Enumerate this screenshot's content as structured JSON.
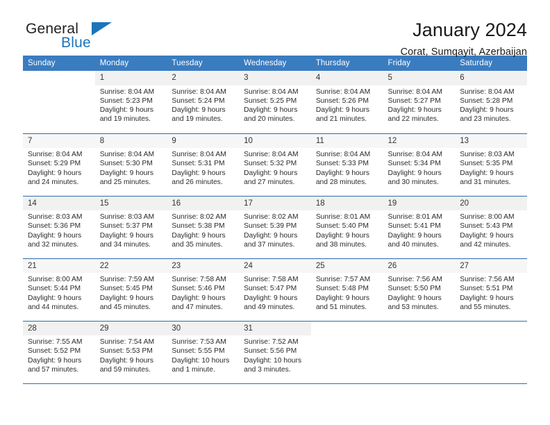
{
  "brand": {
    "name_part1": "General",
    "name_part2": "Blue",
    "logo_icon": "triangle-icon"
  },
  "header": {
    "title": "January 2024",
    "location": "Corat, Sumqayit, Azerbaijan"
  },
  "colors": {
    "header_bg": "#3a7cc0",
    "header_text": "#ffffff",
    "brand_blue": "#1b75bb",
    "daynum_bg": "#f1f1f1",
    "row_border": "#2f6ca8",
    "body_text": "#2b2b2b"
  },
  "calendar": {
    "weekdays": [
      "Sunday",
      "Monday",
      "Tuesday",
      "Wednesday",
      "Thursday",
      "Friday",
      "Saturday"
    ],
    "weeks": [
      [
        {
          "day": "",
          "sunrise": "",
          "sunset": "",
          "daylight": "",
          "daylight2": ""
        },
        {
          "day": "1",
          "sunrise": "Sunrise: 8:04 AM",
          "sunset": "Sunset: 5:23 PM",
          "daylight": "Daylight: 9 hours",
          "daylight2": "and 19 minutes."
        },
        {
          "day": "2",
          "sunrise": "Sunrise: 8:04 AM",
          "sunset": "Sunset: 5:24 PM",
          "daylight": "Daylight: 9 hours",
          "daylight2": "and 19 minutes."
        },
        {
          "day": "3",
          "sunrise": "Sunrise: 8:04 AM",
          "sunset": "Sunset: 5:25 PM",
          "daylight": "Daylight: 9 hours",
          "daylight2": "and 20 minutes."
        },
        {
          "day": "4",
          "sunrise": "Sunrise: 8:04 AM",
          "sunset": "Sunset: 5:26 PM",
          "daylight": "Daylight: 9 hours",
          "daylight2": "and 21 minutes."
        },
        {
          "day": "5",
          "sunrise": "Sunrise: 8:04 AM",
          "sunset": "Sunset: 5:27 PM",
          "daylight": "Daylight: 9 hours",
          "daylight2": "and 22 minutes."
        },
        {
          "day": "6",
          "sunrise": "Sunrise: 8:04 AM",
          "sunset": "Sunset: 5:28 PM",
          "daylight": "Daylight: 9 hours",
          "daylight2": "and 23 minutes."
        }
      ],
      [
        {
          "day": "7",
          "sunrise": "Sunrise: 8:04 AM",
          "sunset": "Sunset: 5:29 PM",
          "daylight": "Daylight: 9 hours",
          "daylight2": "and 24 minutes."
        },
        {
          "day": "8",
          "sunrise": "Sunrise: 8:04 AM",
          "sunset": "Sunset: 5:30 PM",
          "daylight": "Daylight: 9 hours",
          "daylight2": "and 25 minutes."
        },
        {
          "day": "9",
          "sunrise": "Sunrise: 8:04 AM",
          "sunset": "Sunset: 5:31 PM",
          "daylight": "Daylight: 9 hours",
          "daylight2": "and 26 minutes."
        },
        {
          "day": "10",
          "sunrise": "Sunrise: 8:04 AM",
          "sunset": "Sunset: 5:32 PM",
          "daylight": "Daylight: 9 hours",
          "daylight2": "and 27 minutes."
        },
        {
          "day": "11",
          "sunrise": "Sunrise: 8:04 AM",
          "sunset": "Sunset: 5:33 PM",
          "daylight": "Daylight: 9 hours",
          "daylight2": "and 28 minutes."
        },
        {
          "day": "12",
          "sunrise": "Sunrise: 8:04 AM",
          "sunset": "Sunset: 5:34 PM",
          "daylight": "Daylight: 9 hours",
          "daylight2": "and 30 minutes."
        },
        {
          "day": "13",
          "sunrise": "Sunrise: 8:03 AM",
          "sunset": "Sunset: 5:35 PM",
          "daylight": "Daylight: 9 hours",
          "daylight2": "and 31 minutes."
        }
      ],
      [
        {
          "day": "14",
          "sunrise": "Sunrise: 8:03 AM",
          "sunset": "Sunset: 5:36 PM",
          "daylight": "Daylight: 9 hours",
          "daylight2": "and 32 minutes."
        },
        {
          "day": "15",
          "sunrise": "Sunrise: 8:03 AM",
          "sunset": "Sunset: 5:37 PM",
          "daylight": "Daylight: 9 hours",
          "daylight2": "and 34 minutes."
        },
        {
          "day": "16",
          "sunrise": "Sunrise: 8:02 AM",
          "sunset": "Sunset: 5:38 PM",
          "daylight": "Daylight: 9 hours",
          "daylight2": "and 35 minutes."
        },
        {
          "day": "17",
          "sunrise": "Sunrise: 8:02 AM",
          "sunset": "Sunset: 5:39 PM",
          "daylight": "Daylight: 9 hours",
          "daylight2": "and 37 minutes."
        },
        {
          "day": "18",
          "sunrise": "Sunrise: 8:01 AM",
          "sunset": "Sunset: 5:40 PM",
          "daylight": "Daylight: 9 hours",
          "daylight2": "and 38 minutes."
        },
        {
          "day": "19",
          "sunrise": "Sunrise: 8:01 AM",
          "sunset": "Sunset: 5:41 PM",
          "daylight": "Daylight: 9 hours",
          "daylight2": "and 40 minutes."
        },
        {
          "day": "20",
          "sunrise": "Sunrise: 8:00 AM",
          "sunset": "Sunset: 5:43 PM",
          "daylight": "Daylight: 9 hours",
          "daylight2": "and 42 minutes."
        }
      ],
      [
        {
          "day": "21",
          "sunrise": "Sunrise: 8:00 AM",
          "sunset": "Sunset: 5:44 PM",
          "daylight": "Daylight: 9 hours",
          "daylight2": "and 44 minutes."
        },
        {
          "day": "22",
          "sunrise": "Sunrise: 7:59 AM",
          "sunset": "Sunset: 5:45 PM",
          "daylight": "Daylight: 9 hours",
          "daylight2": "and 45 minutes."
        },
        {
          "day": "23",
          "sunrise": "Sunrise: 7:58 AM",
          "sunset": "Sunset: 5:46 PM",
          "daylight": "Daylight: 9 hours",
          "daylight2": "and 47 minutes."
        },
        {
          "day": "24",
          "sunrise": "Sunrise: 7:58 AM",
          "sunset": "Sunset: 5:47 PM",
          "daylight": "Daylight: 9 hours",
          "daylight2": "and 49 minutes."
        },
        {
          "day": "25",
          "sunrise": "Sunrise: 7:57 AM",
          "sunset": "Sunset: 5:48 PM",
          "daylight": "Daylight: 9 hours",
          "daylight2": "and 51 minutes."
        },
        {
          "day": "26",
          "sunrise": "Sunrise: 7:56 AM",
          "sunset": "Sunset: 5:50 PM",
          "daylight": "Daylight: 9 hours",
          "daylight2": "and 53 minutes."
        },
        {
          "day": "27",
          "sunrise": "Sunrise: 7:56 AM",
          "sunset": "Sunset: 5:51 PM",
          "daylight": "Daylight: 9 hours",
          "daylight2": "and 55 minutes."
        }
      ],
      [
        {
          "day": "28",
          "sunrise": "Sunrise: 7:55 AM",
          "sunset": "Sunset: 5:52 PM",
          "daylight": "Daylight: 9 hours",
          "daylight2": "and 57 minutes."
        },
        {
          "day": "29",
          "sunrise": "Sunrise: 7:54 AM",
          "sunset": "Sunset: 5:53 PM",
          "daylight": "Daylight: 9 hours",
          "daylight2": "and 59 minutes."
        },
        {
          "day": "30",
          "sunrise": "Sunrise: 7:53 AM",
          "sunset": "Sunset: 5:55 PM",
          "daylight": "Daylight: 10 hours",
          "daylight2": "and 1 minute."
        },
        {
          "day": "31",
          "sunrise": "Sunrise: 7:52 AM",
          "sunset": "Sunset: 5:56 PM",
          "daylight": "Daylight: 10 hours",
          "daylight2": "and 3 minutes."
        },
        {
          "day": "",
          "sunrise": "",
          "sunset": "",
          "daylight": "",
          "daylight2": ""
        },
        {
          "day": "",
          "sunrise": "",
          "sunset": "",
          "daylight": "",
          "daylight2": ""
        },
        {
          "day": "",
          "sunrise": "",
          "sunset": "",
          "daylight": "",
          "daylight2": ""
        }
      ]
    ]
  }
}
